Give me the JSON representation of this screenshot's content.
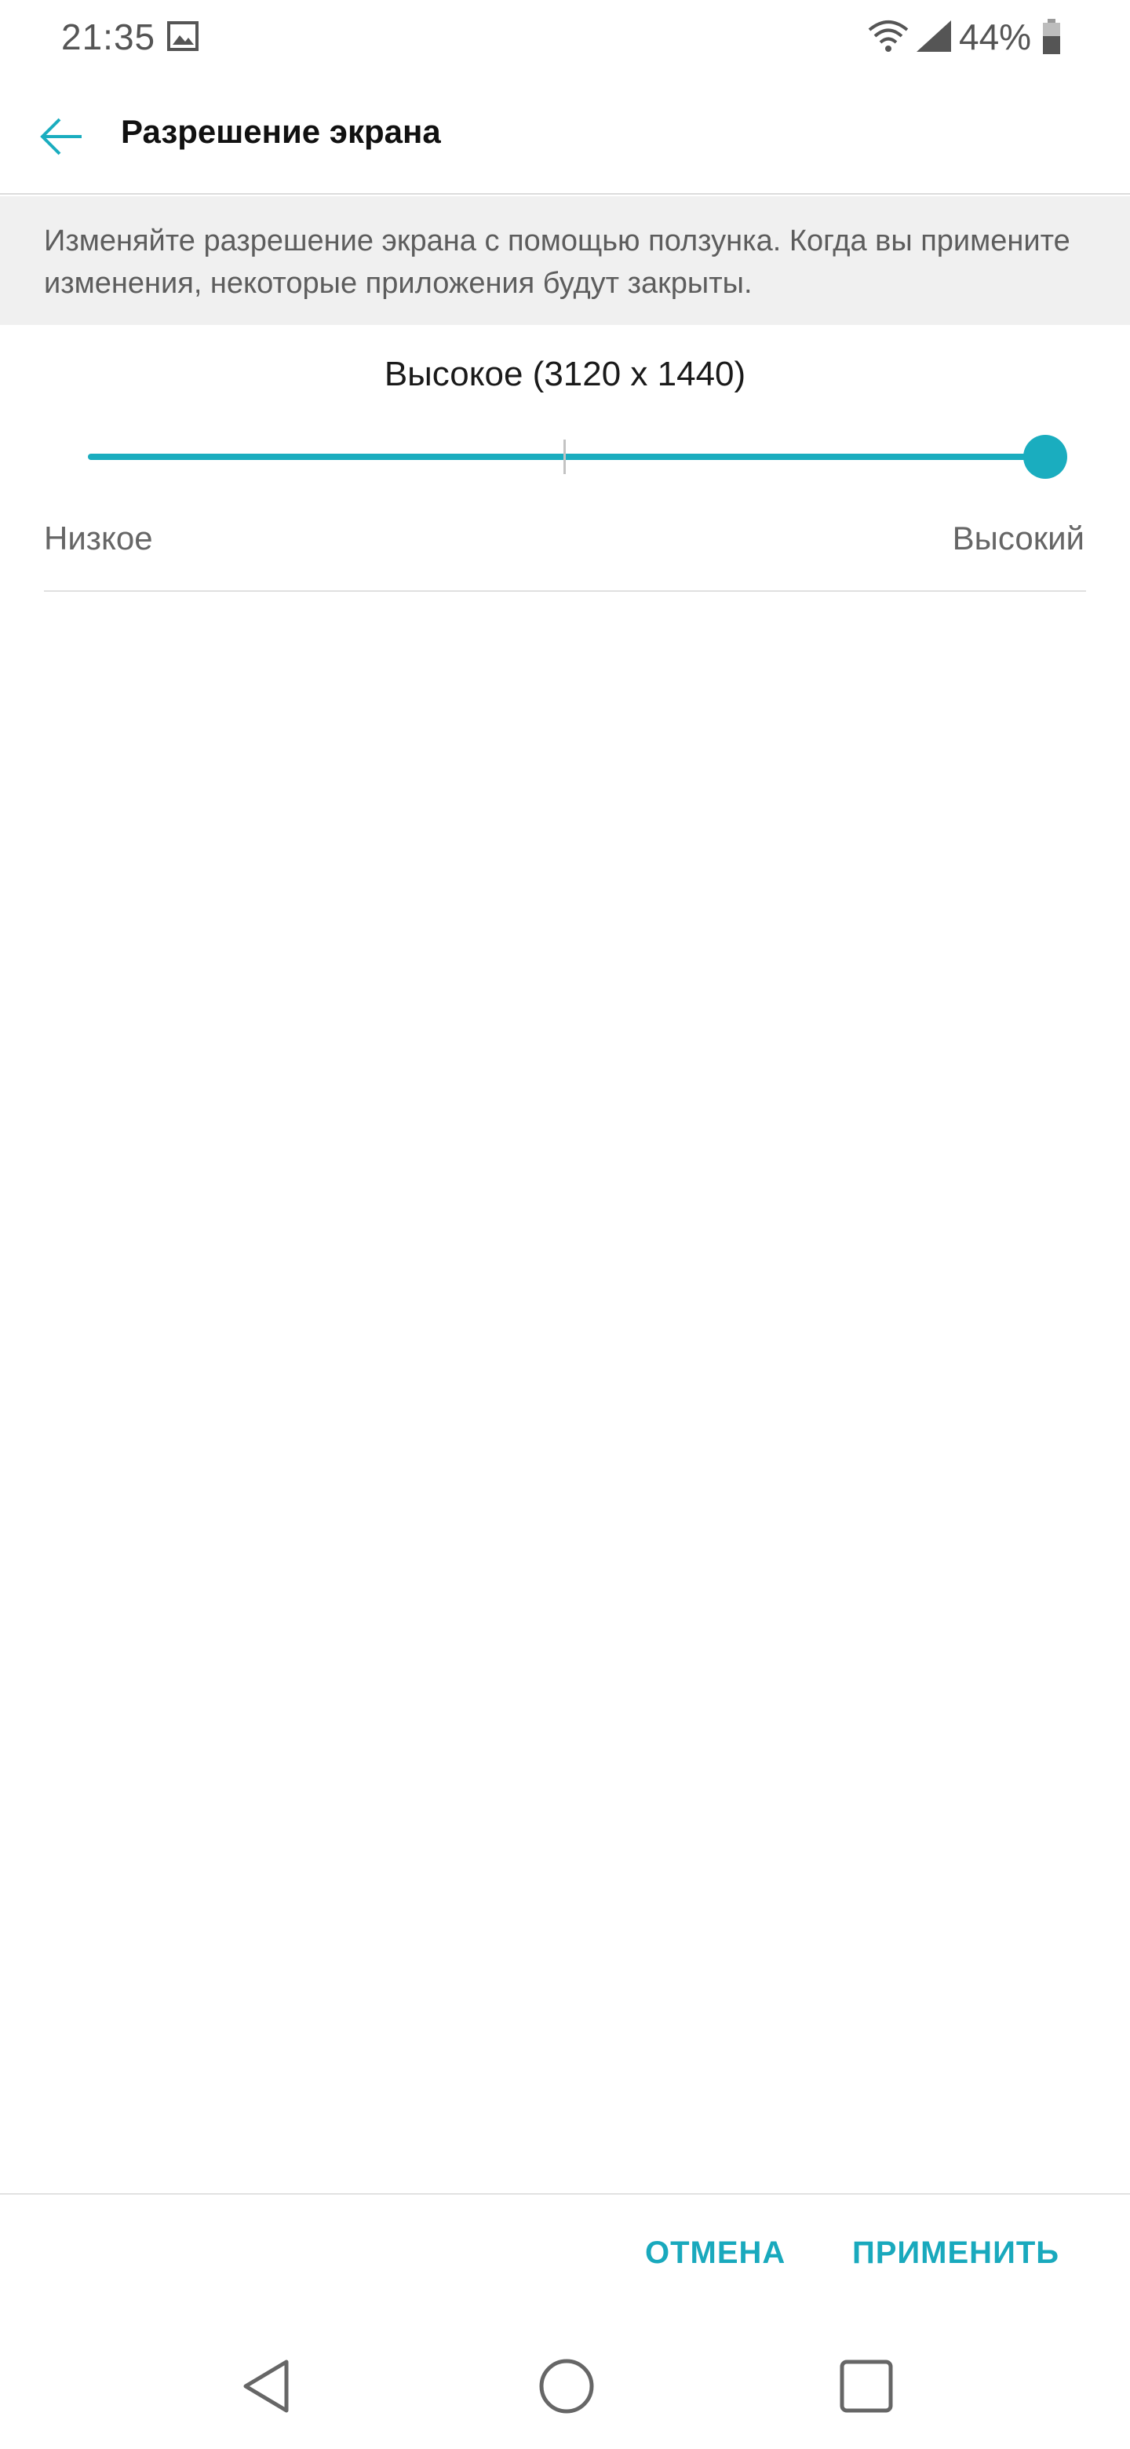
{
  "status_bar": {
    "time": "21:35",
    "battery_percent": "44%",
    "icons": [
      "gallery-icon",
      "wifi-icon",
      "signal-icon",
      "battery-icon"
    ]
  },
  "app_bar": {
    "title": "Разрешение экрана",
    "back_icon": "arrow-left-icon"
  },
  "description": "Изменяйте разрешение экрана с помощью ползунка. Когда вы примените изменения, некоторые приложения будут закрыты.",
  "resolution": {
    "current_label": "Высокое (3120 x 1440)",
    "slider_value": 1.0,
    "slider_steps": 3,
    "low_label": "Низкое",
    "high_label": "Высокий"
  },
  "actions": {
    "cancel_label": "ОТМЕНА",
    "apply_label": "ПРИМЕНИТЬ"
  },
  "nav_bar": {
    "icons": [
      "back-triangle-icon",
      "home-circle-icon",
      "recents-square-icon"
    ]
  },
  "colors": {
    "accent": "#1aadbf",
    "description_bg": "#f0f0f0",
    "text_primary": "#111111",
    "text_secondary": "#666666"
  }
}
